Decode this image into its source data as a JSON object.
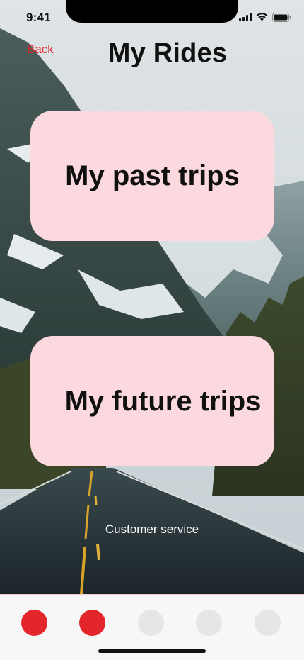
{
  "status_bar": {
    "time": "9:41",
    "icons": [
      "signal-icon",
      "wifi-icon",
      "battery-icon"
    ]
  },
  "header": {
    "back_label": "Back",
    "title": "My Rides"
  },
  "cards": {
    "past_label": "My past trips",
    "future_label": "My future trips"
  },
  "footer": {
    "customer_service_label": "Customer service"
  },
  "bottom_nav": {
    "active_color": "#e2262b",
    "inactive_color": "#e6e6e6",
    "dots": [
      {
        "state": "active"
      },
      {
        "state": "active"
      },
      {
        "state": "inactive"
      },
      {
        "state": "inactive"
      },
      {
        "state": "inactive"
      }
    ]
  },
  "colors": {
    "accent": "#e2262b",
    "card_background": "#fcd8df",
    "text_primary": "#111111"
  }
}
